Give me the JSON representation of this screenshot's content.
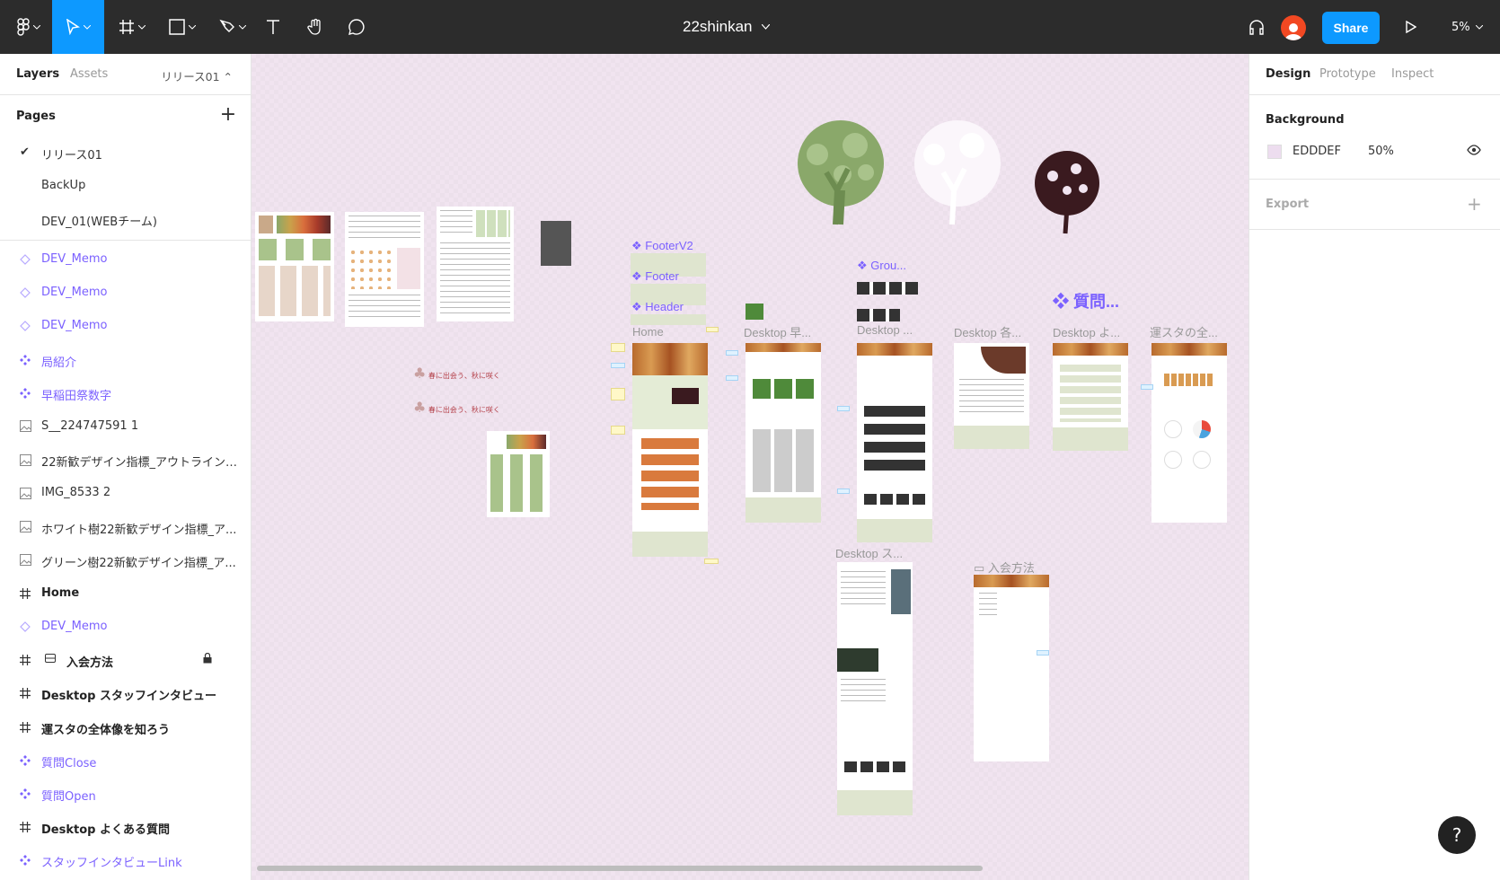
{
  "toolbar": {
    "file_name": "22shinkan",
    "share_label": "Share",
    "zoom": "5%"
  },
  "left_panel": {
    "tabs": [
      "Layers",
      "Assets"
    ],
    "current_page": "リリース01",
    "pages_title": "Pages",
    "pages": [
      {
        "label": "リリース01",
        "selected": true
      },
      {
        "label": "BackUp",
        "selected": false
      },
      {
        "label": "DEV_01(WEBチーム)",
        "selected": false
      }
    ],
    "layers": [
      {
        "label": "DEV_Memo",
        "kind": "instance"
      },
      {
        "label": "DEV_Memo",
        "kind": "instance"
      },
      {
        "label": "DEV_Memo",
        "kind": "instance"
      },
      {
        "label": "局紹介",
        "kind": "component"
      },
      {
        "label": "早稲田祭数字",
        "kind": "component"
      },
      {
        "label": "S__224747591 1",
        "kind": "image"
      },
      {
        "label": "22新歓デザイン指標_アウトライン_...",
        "kind": "image"
      },
      {
        "label": "IMG_8533 2",
        "kind": "image"
      },
      {
        "label": "ホワイト樹22新歓デザイン指標_ア...",
        "kind": "image"
      },
      {
        "label": "グリーン樹22新歓デザイン指標_ア...",
        "kind": "image"
      },
      {
        "label": "Home",
        "kind": "frame"
      },
      {
        "label": "DEV_Memo",
        "kind": "instance"
      },
      {
        "label": "入会方法",
        "kind": "frame-locked"
      },
      {
        "label": "Desktop スタッフインタビュー",
        "kind": "frame"
      },
      {
        "label": "運スタの全体像を知ろう",
        "kind": "frame"
      },
      {
        "label": "質問Close",
        "kind": "component"
      },
      {
        "label": "質問Open",
        "kind": "component"
      },
      {
        "label": "Desktop よくある質問",
        "kind": "frame"
      },
      {
        "label": "スタッフインタビューLink",
        "kind": "component"
      }
    ]
  },
  "canvas": {
    "component_labels": [
      "FooterV2",
      "Footer",
      "Header",
      "Grou...",
      "質問..."
    ],
    "frame_labels": [
      "Home",
      "Desktop 早...",
      "Desktop ...",
      "Desktop 各...",
      "Desktop よ...",
      "運スタの全...",
      "Desktop ス...",
      "入会方法"
    ],
    "banner_text": [
      "春に出会う、秋に咲く",
      "春に出会う、秋に咲く"
    ]
  },
  "right_panel": {
    "tabs": [
      "Design",
      "Prototype",
      "Inspect"
    ],
    "background_title": "Background",
    "background_hex": "EDDDEF",
    "background_opacity": "50%",
    "export_title": "Export"
  },
  "colors": {
    "toolbar_bg": "#2c2c2c",
    "accent_blue": "#0d99ff",
    "component_purple": "#7b61ff",
    "canvas_bg": "#edddef",
    "tree_green": "#8aa86a",
    "tree_dark": "#3a1a1f"
  },
  "help_label": "?"
}
